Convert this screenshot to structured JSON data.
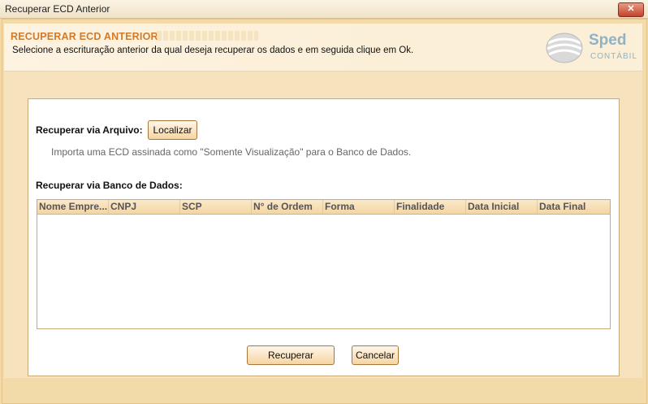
{
  "window": {
    "title": "Recuperar ECD Anterior",
    "close_label": "✕"
  },
  "header": {
    "heading": "RECUPERAR ECD ANTERIOR",
    "description": "Selecione a escrituração anterior da qual deseja recuperar os dados e em seguida clique em Ok.",
    "logo_main": "Sped",
    "logo_sub": "CONTÁBIL"
  },
  "file_section": {
    "label": "Recuperar via Arquivo:",
    "button": "Localizar",
    "hint": "Importa uma ECD assinada como \"Somente Visualização\" para o Banco de Dados."
  },
  "db_section": {
    "label": "Recuperar via Banco de Dados:",
    "columns": [
      "Nome Empre...",
      "CNPJ",
      "SCP",
      "N° de Ordem",
      "Forma",
      "Finalidade",
      "Data Inicial",
      "Data Final"
    ],
    "rows": []
  },
  "actions": {
    "recover": "Recuperar",
    "cancel": "Cancelar"
  },
  "colors": {
    "accent": "#d17a2a",
    "frame": "#f3dba9",
    "logo": "#8fb3c5"
  }
}
